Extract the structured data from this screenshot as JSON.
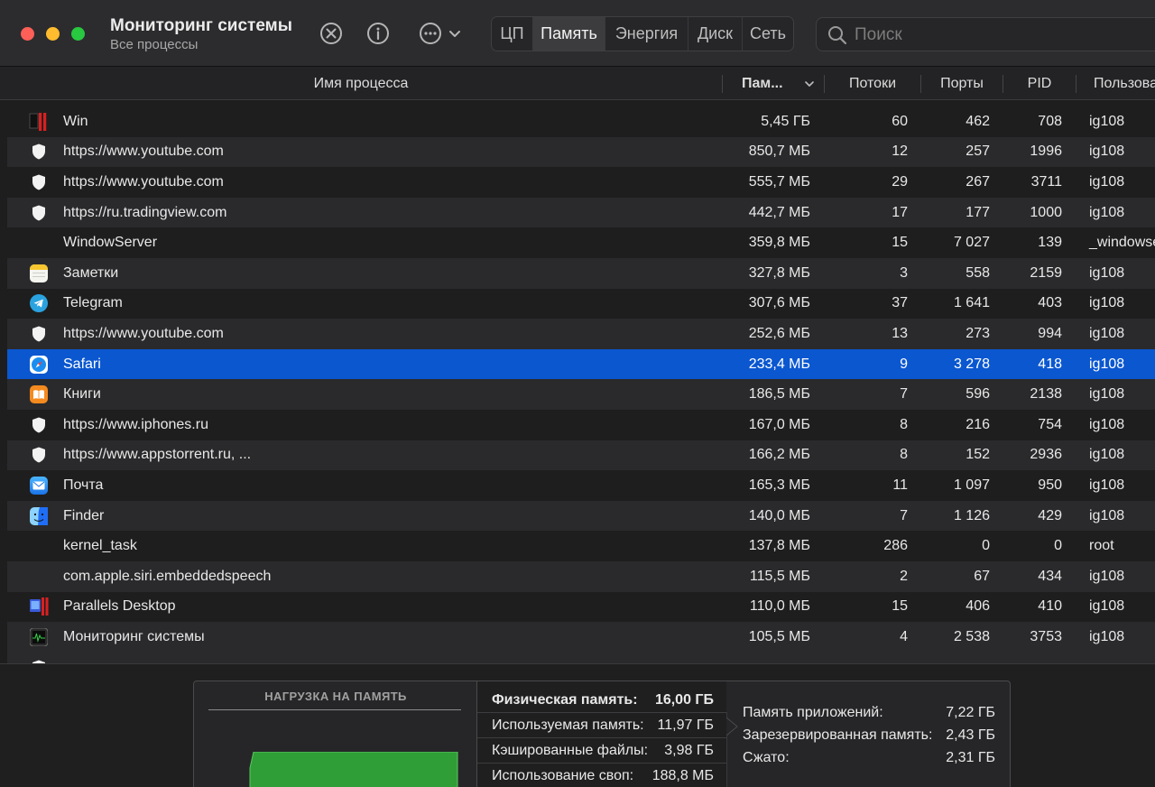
{
  "window": {
    "title": "Мониторинг системы",
    "subtitle": "Все процессы"
  },
  "toolbar": {
    "stop_icon": "x-circle-icon",
    "info_icon": "info-icon",
    "more_icon": "ellipsis-circle-icon",
    "tabs": [
      {
        "label": "ЦП",
        "active": false
      },
      {
        "label": "Память",
        "active": true
      },
      {
        "label": "Энергия",
        "active": false
      },
      {
        "label": "Диск",
        "active": false
      },
      {
        "label": "Сеть",
        "active": false
      }
    ],
    "search_placeholder": "Поиск"
  },
  "columns": {
    "name": "Имя процесса",
    "memory": "Пам...",
    "threads": "Потоки",
    "ports": "Порты",
    "pid": "PID",
    "user": "Пользова"
  },
  "processes": [
    {
      "name": "Win",
      "icon": "parallels-vm-icon",
      "memory": "5,45 ГБ",
      "threads": "60",
      "ports": "462",
      "pid": "708",
      "user": "ig108"
    },
    {
      "name": "https://www.youtube.com",
      "icon": "shield-icon",
      "memory": "850,7 МБ",
      "threads": "12",
      "ports": "257",
      "pid": "1996",
      "user": "ig108"
    },
    {
      "name": "https://www.youtube.com",
      "icon": "shield-icon",
      "memory": "555,7 МБ",
      "threads": "29",
      "ports": "267",
      "pid": "3711",
      "user": "ig108"
    },
    {
      "name": "https://ru.tradingview.com",
      "icon": "shield-icon",
      "memory": "442,7 МБ",
      "threads": "17",
      "ports": "177",
      "pid": "1000",
      "user": "ig108"
    },
    {
      "name": "WindowServer",
      "icon": "none",
      "memory": "359,8 МБ",
      "threads": "15",
      "ports": "7 027",
      "pid": "139",
      "user": "_windowse"
    },
    {
      "name": "Заметки",
      "icon": "notes-icon",
      "memory": "327,8 МБ",
      "threads": "3",
      "ports": "558",
      "pid": "2159",
      "user": "ig108"
    },
    {
      "name": "Telegram",
      "icon": "telegram-icon",
      "memory": "307,6 МБ",
      "threads": "37",
      "ports": "1 641",
      "pid": "403",
      "user": "ig108"
    },
    {
      "name": "https://www.youtube.com",
      "icon": "shield-icon",
      "memory": "252,6 МБ",
      "threads": "13",
      "ports": "273",
      "pid": "994",
      "user": "ig108"
    },
    {
      "name": "Safari",
      "icon": "safari-icon",
      "memory": "233,4 МБ",
      "threads": "9",
      "ports": "3 278",
      "pid": "418",
      "user": "ig108",
      "selected": true
    },
    {
      "name": "Книги",
      "icon": "books-icon",
      "memory": "186,5 МБ",
      "threads": "7",
      "ports": "596",
      "pid": "2138",
      "user": "ig108"
    },
    {
      "name": "https://www.iphones.ru",
      "icon": "shield-icon",
      "memory": "167,0 МБ",
      "threads": "8",
      "ports": "216",
      "pid": "754",
      "user": "ig108"
    },
    {
      "name": "https://www.appstorrent.ru, ...",
      "icon": "shield-icon",
      "memory": "166,2 МБ",
      "threads": "8",
      "ports": "152",
      "pid": "2936",
      "user": "ig108"
    },
    {
      "name": "Почта",
      "icon": "mail-icon",
      "memory": "165,3 МБ",
      "threads": "11",
      "ports": "1 097",
      "pid": "950",
      "user": "ig108"
    },
    {
      "name": "Finder",
      "icon": "finder-icon",
      "memory": "140,0 МБ",
      "threads": "7",
      "ports": "1 126",
      "pid": "429",
      "user": "ig108"
    },
    {
      "name": "kernel_task",
      "icon": "none",
      "memory": "137,8 МБ",
      "threads": "286",
      "ports": "0",
      "pid": "0",
      "user": "root"
    },
    {
      "name": "com.apple.siri.embeddedspeech",
      "icon": "none",
      "memory": "115,5 МБ",
      "threads": "2",
      "ports": "67",
      "pid": "434",
      "user": "ig108"
    },
    {
      "name": "Parallels Desktop",
      "icon": "parallels-icon",
      "memory": "110,0 МБ",
      "threads": "15",
      "ports": "406",
      "pid": "410",
      "user": "ig108"
    },
    {
      "name": "Мониторинг системы",
      "icon": "activity-monitor-icon",
      "memory": "105,5 МБ",
      "threads": "4",
      "ports": "2 538",
      "pid": "3753",
      "user": "ig108"
    }
  ],
  "memory_panel": {
    "pressure_title": "НАГРУЗКА НА ПАМЯТЬ",
    "pressure_color": "#2f9e37",
    "stats_left": [
      {
        "label": "Физическая память:",
        "value": "16,00 ГБ"
      },
      {
        "label": "Используемая память:",
        "value": "11,97 ГБ"
      },
      {
        "label": "Кэшированные файлы:",
        "value": "3,98 ГБ"
      },
      {
        "label": "Использование своп:",
        "value": "188,8 МБ"
      }
    ],
    "stats_right": [
      {
        "label": "Память приложений:",
        "value": "7,22 ГБ"
      },
      {
        "label": "Зарезервированная память:",
        "value": "2,43 ГБ"
      },
      {
        "label": "Сжато:",
        "value": "2,31 ГБ"
      }
    ]
  }
}
